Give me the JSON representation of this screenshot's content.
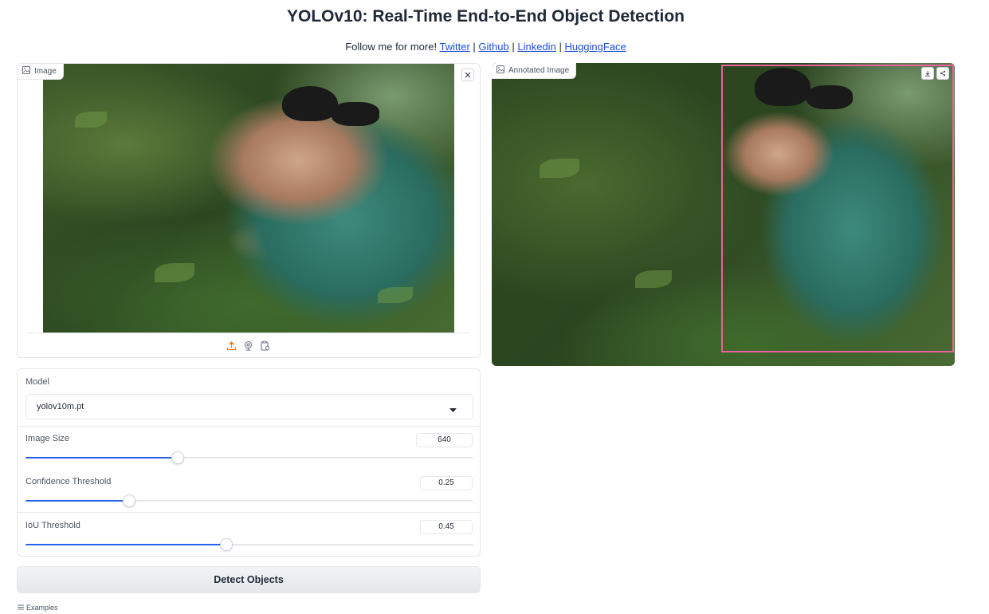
{
  "header": {
    "title": "YOLOv10: Real-Time End-to-End Object Detection",
    "follow_text": "Follow me for more!",
    "links": [
      "Twitter",
      "Github",
      "Linkedin",
      "HuggingFace"
    ],
    "separator": "|"
  },
  "input_image": {
    "label": "Image",
    "clear_icon": "close-icon",
    "sources": [
      "upload-icon",
      "webcam-icon",
      "clipboard-icon"
    ]
  },
  "output_image": {
    "label": "Annotated Image",
    "actions": [
      "download-icon",
      "share-icon"
    ],
    "box_color": "#e8619d"
  },
  "controls": {
    "model": {
      "label": "Model",
      "value": "yolov10m.pt"
    },
    "image_size": {
      "label": "Image Size",
      "value": "640",
      "fraction": 0.338
    },
    "confidence": {
      "label": "Confidence Threshold",
      "value": "0.25",
      "fraction": 0.23
    },
    "iou": {
      "label": "IoU Threshold",
      "value": "0.45",
      "fraction": 0.447
    }
  },
  "detect_button": {
    "label": "Detect Objects"
  },
  "examples": {
    "label": "Examples"
  },
  "colors": {
    "accent": "#2563eb",
    "link": "#1d4ed8",
    "upload_icon": "#f97316"
  }
}
